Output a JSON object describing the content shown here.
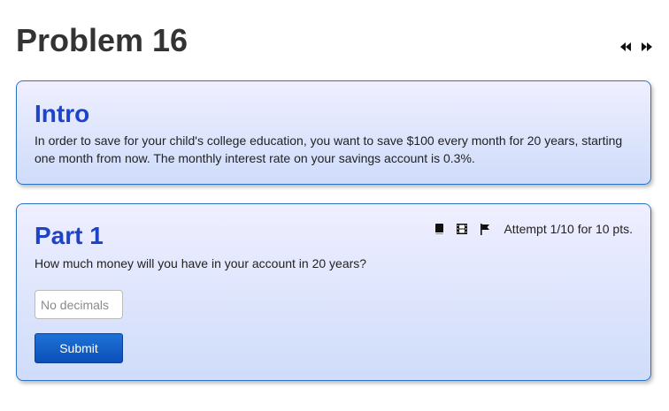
{
  "page": {
    "title": "Problem 16"
  },
  "nav": {
    "prev_icon": "rewind-icon",
    "next_icon": "fast-forward-icon"
  },
  "intro": {
    "heading": "Intro",
    "text": "In order to save for your child's college education, you want to save $100 every month for 20 years, starting one month from now. The monthly interest rate on your savings account is 0.3%."
  },
  "part1": {
    "heading": "Part 1",
    "question": "How much money will you have in your account in 20 years?",
    "answer_value": "",
    "answer_placeholder": "No decimals",
    "submit_label": "Submit",
    "attempt_text": "Attempt 1/10 for 10 pts.",
    "tool_icons": [
      "book-icon",
      "film-icon",
      "flag-icon"
    ]
  },
  "colors": {
    "heading": "#1d44c8",
    "card_border": "#2a72c4",
    "button": "#0a4fb8"
  }
}
